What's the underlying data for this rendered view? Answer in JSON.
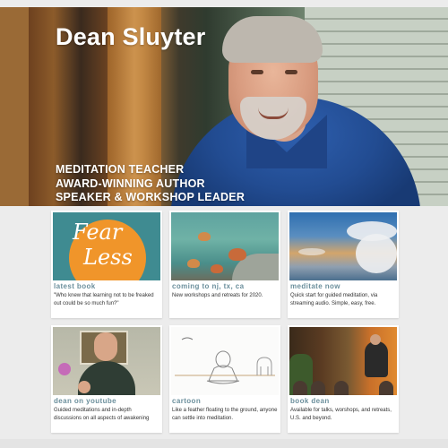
{
  "hero": {
    "title": "Dean Sluyter",
    "tags": [
      "MEDITATION TEACHER",
      "AWARD-WINNING AUTHOR",
      "SPEAKER & WORKSHOP LEADER"
    ]
  },
  "cards": [
    {
      "title": "latest book",
      "desc": "\"Who knew that learning not to be freaked out could be so much fun?\"",
      "image": "fear-less-book-cover",
      "cover_text": [
        "Fear",
        "Less"
      ]
    },
    {
      "title": "coming to nj, tx, ca",
      "desc": "New workshops and retreats for 2020.",
      "image": "butterflies-painting"
    },
    {
      "title": "meditate now",
      "desc": "Quick start for guided meditation, via streaming audio. Simple, easy, free.",
      "image": "sky-clouds"
    },
    {
      "title": "dean on youtube",
      "desc": "Guided meditations and in-depth discussions on all aspects of awakening",
      "image": "video-still"
    },
    {
      "title": "cartoon",
      "desc": "Like a feather floating to the ground, anyone can settle into meditation.",
      "image": "meditating-figure-cartoon"
    },
    {
      "title": "book dean",
      "desc": "Available for talks, worshops, and retreats, U.S. and beyond.",
      "image": "talk-photo"
    }
  ],
  "colors": {
    "card_title": "#6b8f9c",
    "page_bg": "#ececec",
    "book_orange": "#f0952a",
    "book_teal": "#3f8b91"
  }
}
